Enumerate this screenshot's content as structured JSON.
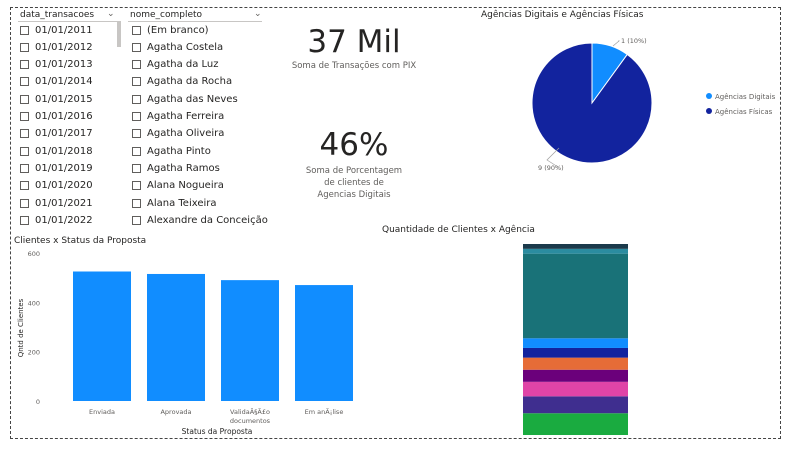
{
  "slicer_date": {
    "header": "data_transacoes",
    "items": [
      "01/01/2011",
      "01/01/2012",
      "01/01/2013",
      "01/01/2014",
      "01/01/2015",
      "01/01/2016",
      "01/01/2017",
      "01/01/2018",
      "01/01/2019",
      "01/01/2020",
      "01/01/2021",
      "01/01/2022"
    ]
  },
  "slicer_name": {
    "header": "nome_completo",
    "items": [
      "(Em branco)",
      "Agatha Costela",
      "Agatha da Luz",
      "Agatha da Rocha",
      "Agatha das Neves",
      "Agatha Ferreira",
      "Agatha Oliveira",
      "Agatha Pinto",
      "Agatha Ramos",
      "Alana Nogueira",
      "Alana Teixeira",
      "Alexandre da Conceição"
    ]
  },
  "kpi1": {
    "value": "37 Mil",
    "caption": "Soma de Transações com PIX"
  },
  "kpi2": {
    "value": "46%",
    "caption_lines": [
      "Soma de Porcentagem",
      "de clientes de",
      "Agencias Digitais"
    ]
  },
  "colors": {
    "bar": "#118DFF",
    "pie_digital": "#118DFF",
    "pie_fisica": "#12239E",
    "stack": [
      "#1AAB40",
      "#3F2E8F",
      "#E044A7",
      "#6B007B",
      "#E66C37",
      "#12239E",
      "#118DFF",
      "#197278",
      "#2B8CA0",
      "#1B3A4B"
    ]
  },
  "chart_data": [
    {
      "type": "pie",
      "title": "Agências Digitais e Agências Físicas",
      "slices": [
        {
          "name": "Agências Digitais",
          "value": 1,
          "label": "1 (10%)"
        },
        {
          "name": "Agências Físicas",
          "value": 9,
          "label": "9 (90%)"
        }
      ],
      "legend": "right"
    },
    {
      "type": "bar",
      "title": "Clientes x Status da Proposta",
      "xlabel": "Status da Proposta",
      "ylabel": "Qntd de Clientes",
      "categories": [
        "Enviada",
        "Aprovada",
        "ValidaÃ§Ã£o documentos",
        "Em anÃ¡lise"
      ],
      "category_lines": [
        [
          "Enviada"
        ],
        [
          "Aprovada"
        ],
        [
          "ValidaÃ§Ã£o",
          "documentos"
        ],
        [
          "Em anÃ¡lise"
        ]
      ],
      "values": [
        525,
        515,
        490,
        470
      ],
      "yticks": [
        "0",
        "200",
        "400",
        "600"
      ],
      "ylim": [
        0,
        600
      ]
    },
    {
      "type": "bar",
      "title": "Quantidade de Clientes x Agência",
      "stacked": true,
      "segments_bottom_to_top": [
        9,
        7,
        6,
        5,
        5,
        4,
        4,
        35,
        2,
        2
      ]
    }
  ]
}
